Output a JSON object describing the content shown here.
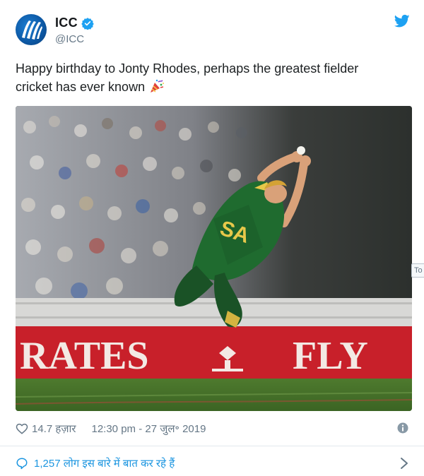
{
  "account": {
    "name": "ICC",
    "handle": "@ICC",
    "avatar_icon": "icc-logo-icon",
    "verified_icon": "verified-badge-icon"
  },
  "brand_icon": "twitter-bird-icon",
  "tweet": {
    "text_line1": "Happy birthday to Jonty Rhodes, perhaps the greatest fielder",
    "text_line2": "cricket has ever known",
    "emoji": "party-popper-icon"
  },
  "media": {
    "banner_left": "RATES",
    "banner_right": "FLY",
    "shirt_text": "SA"
  },
  "side_tab_label": "To",
  "meta": {
    "likes": "14.7 हज़ार",
    "timestamp": "12:30 pm - 27 जुल॰ 2019"
  },
  "conversation": {
    "label": "1,257 लोग इस बारे में बात कर रहे हैं"
  },
  "colors": {
    "twitter_blue": "#1da1f2",
    "link_blue": "#1b95e0",
    "muted": "#657786",
    "banner_red": "#c8202a"
  }
}
